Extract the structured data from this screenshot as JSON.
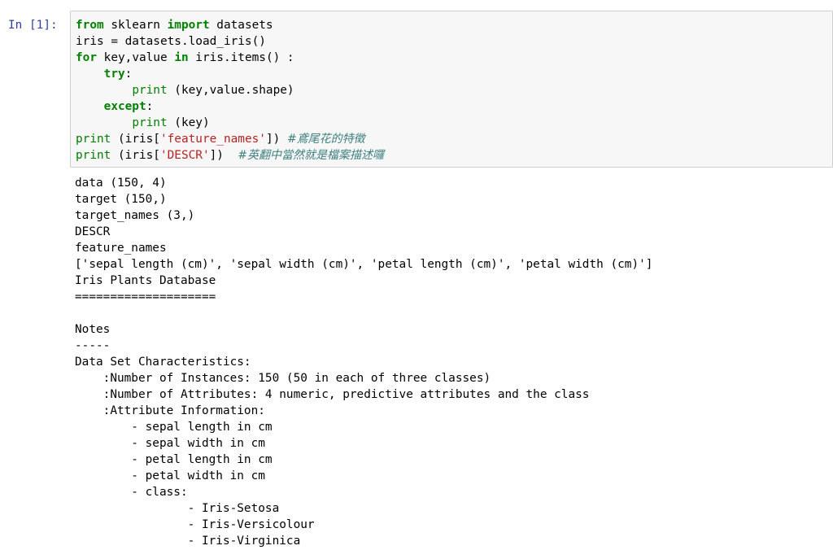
{
  "cell": {
    "prompt": "In [1]:",
    "code_lines": [
      [
        {
          "t": "kw",
          "v": "from"
        },
        {
          "t": "n",
          "v": " sklearn "
        },
        {
          "t": "kw",
          "v": "import"
        },
        {
          "t": "n",
          "v": " datasets"
        }
      ],
      [
        {
          "t": "n",
          "v": "iris = datasets.load_iris()"
        }
      ],
      [
        {
          "t": "kw",
          "v": "for"
        },
        {
          "t": "n",
          "v": " key,value "
        },
        {
          "t": "kw",
          "v": "in"
        },
        {
          "t": "n",
          "v": " iris.items() :"
        }
      ],
      [
        {
          "t": "n",
          "v": "    "
        },
        {
          "t": "kw",
          "v": "try"
        },
        {
          "t": "n",
          "v": ":"
        }
      ],
      [
        {
          "t": "n",
          "v": "        "
        },
        {
          "t": "fn",
          "v": "print"
        },
        {
          "t": "n",
          "v": " (key,value.shape)"
        }
      ],
      [
        {
          "t": "n",
          "v": "    "
        },
        {
          "t": "kw",
          "v": "except"
        },
        {
          "t": "n",
          "v": ":"
        }
      ],
      [
        {
          "t": "n",
          "v": "        "
        },
        {
          "t": "fn",
          "v": "print"
        },
        {
          "t": "n",
          "v": " (key)"
        }
      ],
      [
        {
          "t": "fn",
          "v": "print"
        },
        {
          "t": "n",
          "v": " (iris["
        },
        {
          "t": "st",
          "v": "'feature_names'"
        },
        {
          "t": "n",
          "v": "]) "
        },
        {
          "t": "cm",
          "v": "#鳶尾花的特徵"
        }
      ],
      [
        {
          "t": "fn",
          "v": "print"
        },
        {
          "t": "n",
          "v": " (iris["
        },
        {
          "t": "st",
          "v": "'DESCR'"
        },
        {
          "t": "n",
          "v": "])  "
        },
        {
          "t": "cm",
          "v": "#英翻中當然就是檔案描述囉"
        }
      ]
    ],
    "output_lines": [
      "data (150, 4)",
      "target (150,)",
      "target_names (3,)",
      "DESCR",
      "feature_names",
      "['sepal length (cm)', 'sepal width (cm)', 'petal length (cm)', 'petal width (cm)']",
      "Iris Plants Database",
      "====================",
      "",
      "Notes",
      "-----",
      "Data Set Characteristics:",
      "    :Number of Instances: 150 (50 in each of three classes)",
      "    :Number of Attributes: 4 numeric, predictive attributes and the class",
      "    :Attribute Information:",
      "        - sepal length in cm",
      "        - sepal width in cm",
      "        - petal length in cm",
      "        - petal width in cm",
      "        - class:",
      "                - Iris-Setosa",
      "                - Iris-Versicolour",
      "                - Iris-Virginica"
    ]
  },
  "colors": {
    "keyword": "#008000",
    "string": "#ba2121",
    "comment": "#408080",
    "prompt": "#303f9f",
    "input_background": "#f7f7f7",
    "input_border": "#cfcfcf"
  }
}
